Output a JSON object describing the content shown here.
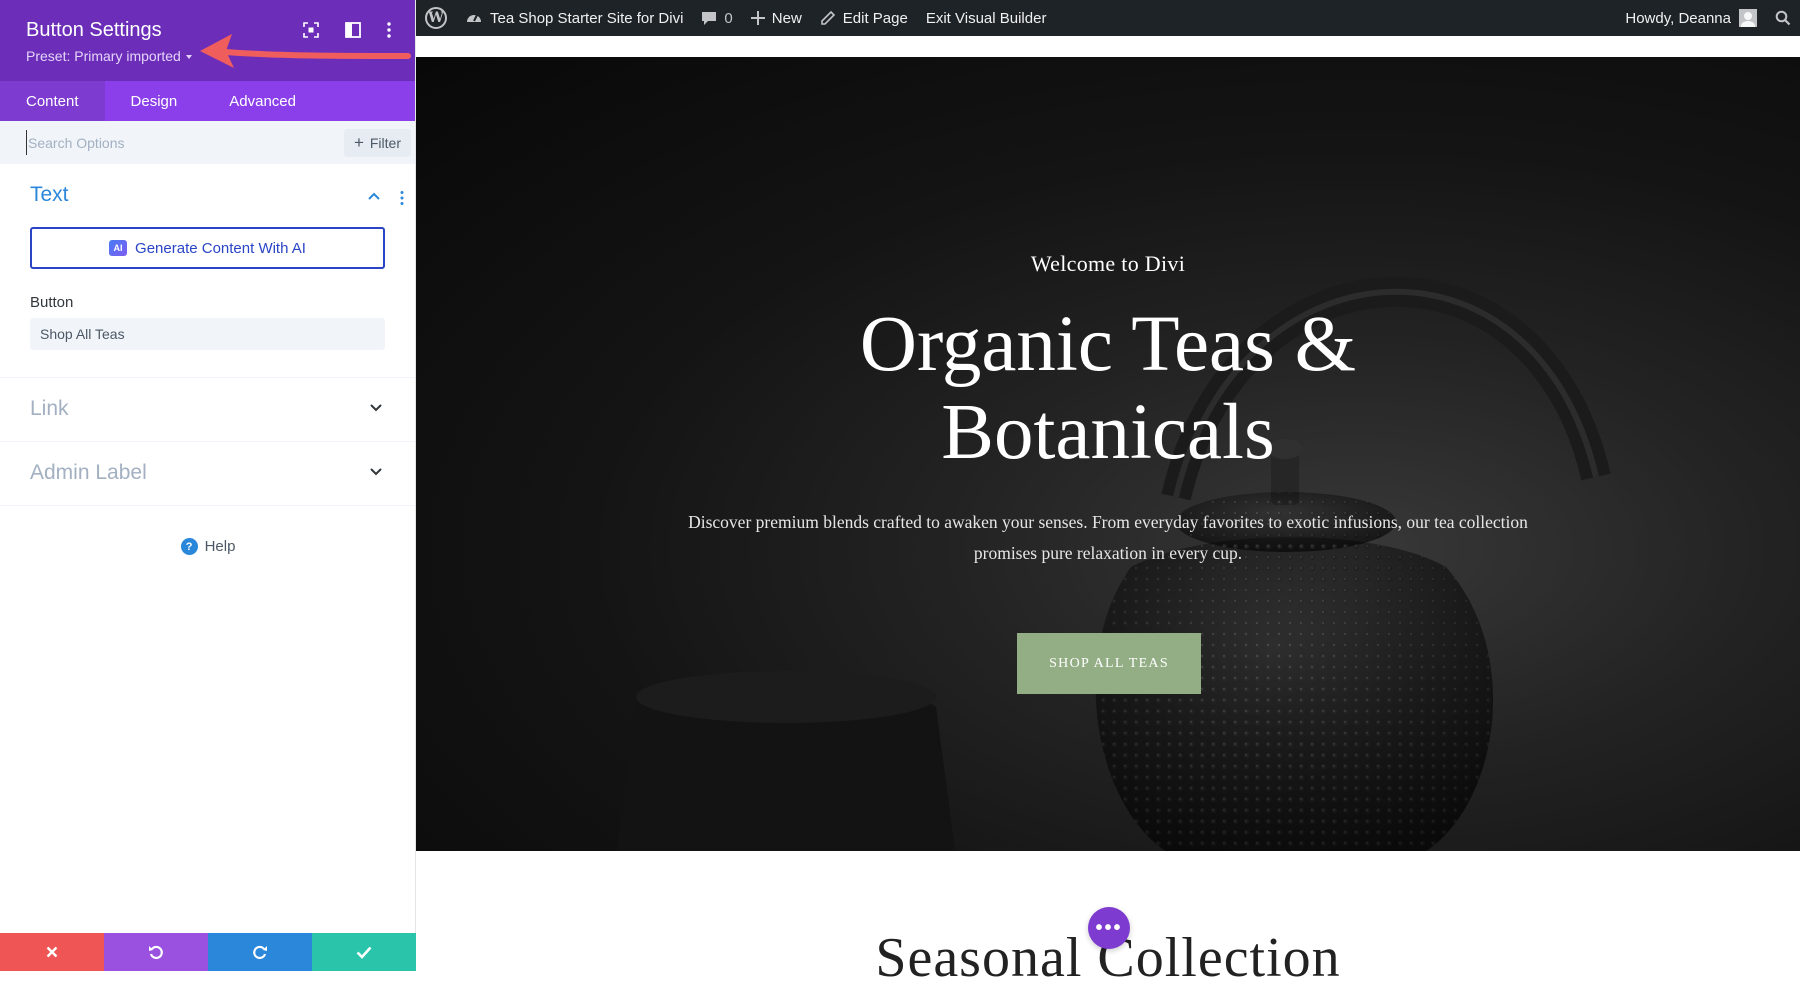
{
  "admin_bar": {
    "site_name": "Tea Shop Starter Site for Divi",
    "comments_count": "0",
    "new_label": "New",
    "edit_page_label": "Edit Page",
    "exit_builder_label": "Exit Visual Builder",
    "greeting": "Howdy, Deanna",
    "icons": [
      "wordpress-logo",
      "dashboard-gauge",
      "comment-bubble",
      "plus",
      "pencil",
      "avatar",
      "search"
    ]
  },
  "settings_panel": {
    "title": "Button Settings",
    "preset": "Preset: Primary imported",
    "header_icons": [
      "focus-icon",
      "split-view-icon",
      "more-vertical-icon"
    ],
    "tabs": [
      {
        "label": "Content",
        "active": true
      },
      {
        "label": "Design",
        "active": false
      },
      {
        "label": "Advanced",
        "active": false
      }
    ],
    "search": {
      "placeholder": "Search Options",
      "value": ""
    },
    "filter_label": "Filter",
    "groups": {
      "text": {
        "title": "Text",
        "expanded": true,
        "ai_button": "Generate Content With AI",
        "ai_badge": "AI",
        "button_field_label": "Button",
        "button_field_value": "Shop All Teas"
      },
      "link": {
        "title": "Link",
        "expanded": false
      },
      "admin_label": {
        "title": "Admin Label",
        "expanded": false
      }
    },
    "help_label": "Help",
    "bottom_actions": [
      {
        "name": "discard",
        "icon": "close-icon",
        "color": "#ef5555"
      },
      {
        "name": "undo",
        "icon": "undo-icon",
        "color": "#9b51e0"
      },
      {
        "name": "redo",
        "icon": "redo-icon",
        "color": "#2b87da"
      },
      {
        "name": "save",
        "icon": "check-icon",
        "color": "#29c4a9"
      }
    ]
  },
  "page": {
    "hero": {
      "kicker": "Welcome to Divi",
      "title": "Organic Teas & Botanicals",
      "description": "Discover premium blends crafted to awaken your senses. From everyday favorites to exotic infusions, our tea collection promises pure relaxation in every cup.",
      "button": "SHOP ALL TEAS"
    },
    "next_section_title": "Seasonal Collection",
    "add_module_dots": "•••"
  },
  "colors": {
    "panel_header": "#6c2eb9",
    "panel_tabs": "#8b3fea",
    "accent_blue": "#2b87da",
    "hero_button": "#93ae85",
    "annotation_arrow": "#ef5d5d"
  }
}
